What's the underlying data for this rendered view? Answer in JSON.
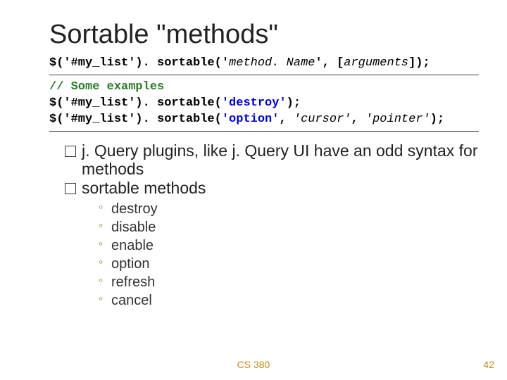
{
  "title": "Sortable \"methods\"",
  "code": {
    "syntax_prefix": "$('#my_list'). sortable('",
    "syntax_method": "method. Name",
    "syntax_between": "', [",
    "syntax_args": "arguments",
    "syntax_suffix": "]);",
    "comment": "// Some examples",
    "ex1_prefix": "$('#my_list'). sortable(",
    "ex1_str": "'destroy'",
    "ex1_suffix": ");",
    "ex2_prefix": "$('#my_list'). sortable(",
    "ex2_str": "'option'",
    "ex2_mid": ", ",
    "ex2_arg1": "'cursor'",
    "ex2_mid2": ", ",
    "ex2_arg2": "'pointer'",
    "ex2_suffix": ");"
  },
  "bullets": {
    "b1": "j. Query plugins, like j. Query UI have an odd syntax for methods",
    "b2": "sortable methods"
  },
  "methods": {
    "m0": "destroy",
    "m1": "disable",
    "m2": "enable",
    "m3": "option",
    "m4": "refresh",
    "m5": "cancel"
  },
  "footer": {
    "course": "CS 380",
    "page": "42"
  }
}
